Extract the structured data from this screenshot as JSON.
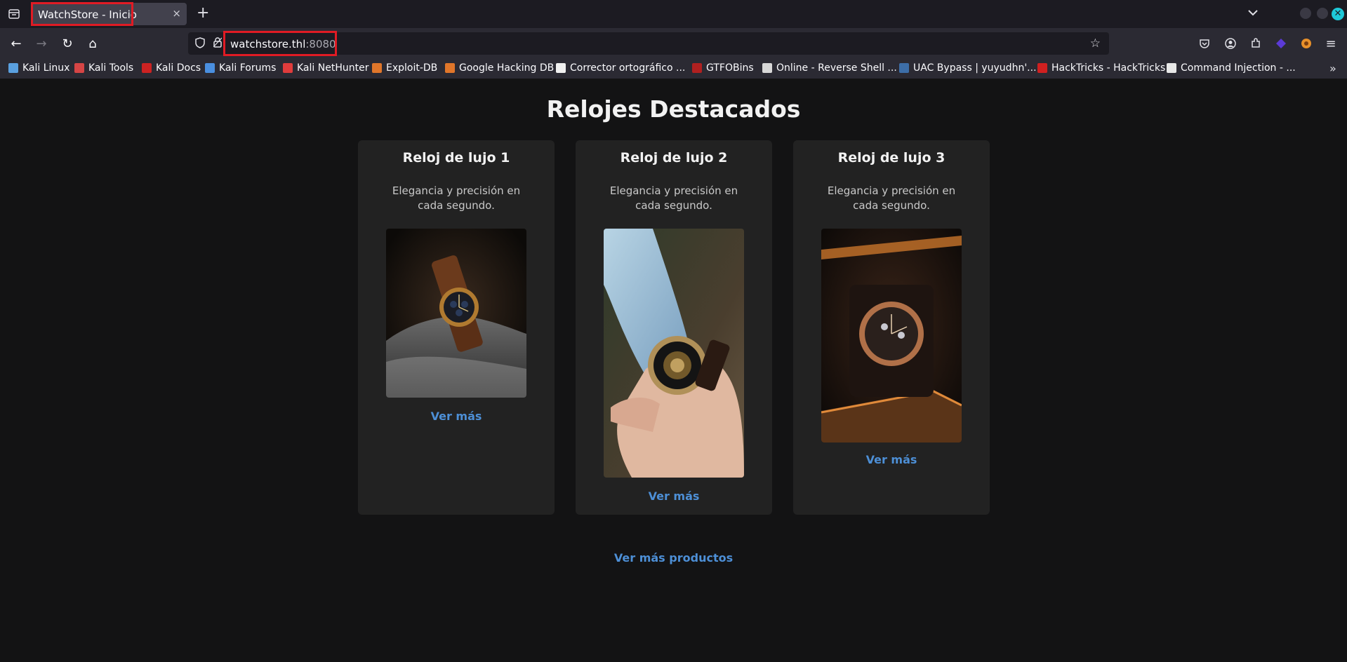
{
  "browser": {
    "tab_title": "WatchStore - Inicio",
    "tab_close_glyph": "×",
    "new_tab_glyph": "+",
    "url_host": "watchstore.thl",
    "url_port": ":8080",
    "back_glyph": "←",
    "forward_glyph": "→",
    "reload_glyph": "↻",
    "home_glyph": "⌂",
    "star_glyph": "☆",
    "overflow_glyph": "»",
    "menu_glyph": "≡"
  },
  "bookmarks": [
    {
      "label": "Kali Linux",
      "icon": "kali-icon",
      "color": "#5aa0e0"
    },
    {
      "label": "Kali Tools",
      "icon": "kali-tools-icon",
      "color": "#d64545"
    },
    {
      "label": "Kali Docs",
      "icon": "kali-docs-icon",
      "color": "#cc2222"
    },
    {
      "label": "Kali Forums",
      "icon": "kali-forums-icon",
      "color": "#4a8fe0"
    },
    {
      "label": "Kali NetHunter",
      "icon": "nethunter-icon",
      "color": "#e03c3c"
    },
    {
      "label": "Exploit-DB",
      "icon": "exploit-db-icon",
      "color": "#e0762a"
    },
    {
      "label": "Google Hacking DB",
      "icon": "ghdb-icon",
      "color": "#e0762a"
    },
    {
      "label": "Corrector ortográfico ...",
      "icon": "corrector-icon",
      "color": "#f0f0f0"
    },
    {
      "label": "GTFOBins",
      "icon": "gtfobins-icon",
      "color": "#b02020"
    },
    {
      "label": "Online - Reverse Shell ...",
      "icon": "skull-icon",
      "color": "#d8d8d8"
    },
    {
      "label": "UAC Bypass | yuyudhn'...",
      "icon": "uac-icon",
      "color": "#3d6ea8"
    },
    {
      "label": "HackTricks - HackTricks",
      "icon": "hacktricks-icon",
      "color": "#d02020"
    },
    {
      "label": "Command Injection - ...",
      "icon": "command-injection-icon",
      "color": "#e8e8e8"
    }
  ],
  "page": {
    "heading": "Relojes Destacados",
    "more_products": "Ver más productos",
    "cards": [
      {
        "title": "Reloj de lujo 1",
        "description": "Elegancia y precisión en cada segundo.",
        "link": "Ver más",
        "image": "watch-on-rock-photo"
      },
      {
        "title": "Reloj de lujo 2",
        "description": "Elegancia y precisión en cada segundo.",
        "link": "Ver más",
        "image": "watch-on-wrist-photo"
      },
      {
        "title": "Reloj de lujo 3",
        "description": "Elegancia y precisión en cada segundo.",
        "link": "Ver más",
        "image": "watch-in-box-photo"
      }
    ]
  },
  "colors": {
    "link": "#4d8fd6",
    "highlight": "#e01b24",
    "page_bg": "#131314",
    "card_bg": "#222222"
  }
}
